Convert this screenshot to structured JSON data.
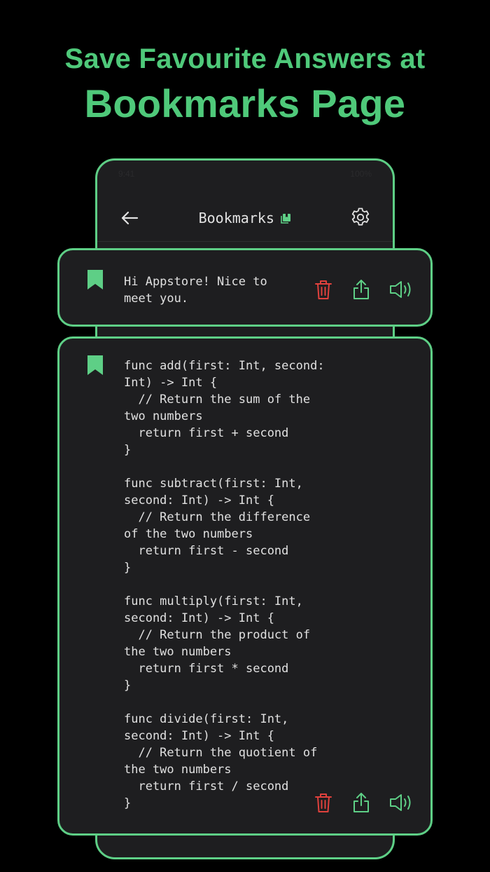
{
  "promo": {
    "line1": "Save Favourite Answers at",
    "line2": "Bookmarks Page"
  },
  "status_bar": {
    "time": "9:41",
    "right": "100%"
  },
  "header": {
    "title": "Bookmarks",
    "back_icon": "arrow-left-icon",
    "title_icon": "bookmarks-stack-icon",
    "settings_icon": "gear-icon"
  },
  "colors": {
    "accent": "#5ecf86",
    "delete": "#e0413d",
    "card_bg": "#1e1e20",
    "background": "#000000"
  },
  "bookmarks": [
    {
      "text": "Hi Appstore! Nice to\nmeet you.",
      "actions": {
        "delete": "trash-icon",
        "share": "share-icon",
        "speak": "speaker-icon"
      }
    },
    {
      "text": "func add(first: Int, second:\nInt) -> Int {\n  // Return the sum of the\ntwo numbers\n  return first + second\n}\n\nfunc subtract(first: Int,\nsecond: Int) -> Int {\n  // Return the difference\nof the two numbers\n  return first - second\n}\n\nfunc multiply(first: Int,\nsecond: Int) -> Int {\n  // Return the product of\nthe two numbers\n  return first * second\n}\n\nfunc divide(first: Int,\nsecond: Int) -> Int {\n  // Return the quotient of\nthe two numbers\n  return first / second\n}",
      "actions": {
        "delete": "trash-icon",
        "share": "share-icon",
        "speak": "speaker-icon"
      }
    }
  ]
}
